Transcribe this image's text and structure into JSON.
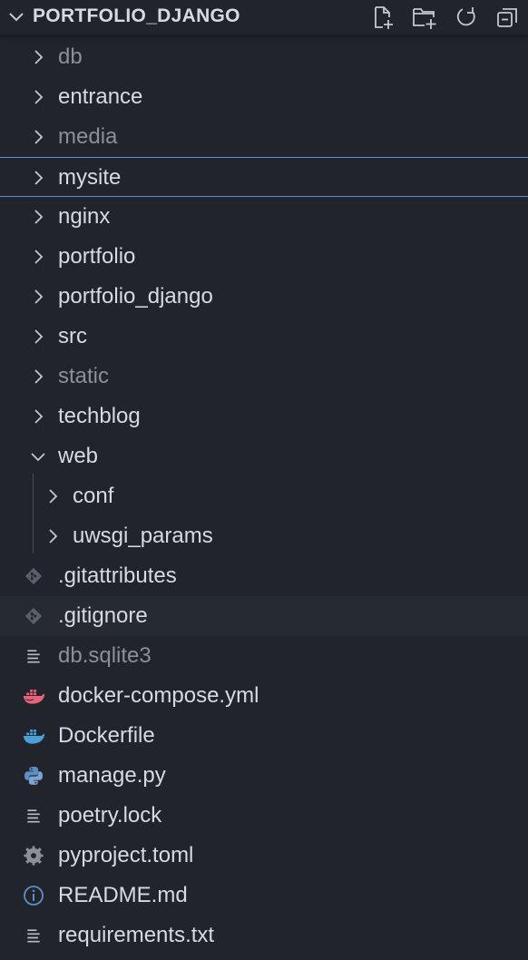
{
  "explorer": {
    "title": "PORTFOLIO_DJANGO",
    "actions": [
      {
        "icon": "new-file-icon"
      },
      {
        "icon": "new-folder-icon"
      },
      {
        "icon": "refresh-icon"
      },
      {
        "icon": "collapse-all-icon"
      }
    ],
    "items": [
      {
        "label": "db",
        "type": "folder",
        "dim": true
      },
      {
        "label": "entrance",
        "type": "folder"
      },
      {
        "label": "media",
        "type": "folder",
        "dim": true
      },
      {
        "label": "mysite",
        "type": "folder",
        "selected": true
      },
      {
        "label": "nginx",
        "type": "folder"
      },
      {
        "label": "portfolio",
        "type": "folder"
      },
      {
        "label": "portfolio_django",
        "type": "folder"
      },
      {
        "label": "src",
        "type": "folder"
      },
      {
        "label": "static",
        "type": "folder",
        "dim": true
      },
      {
        "label": "techblog",
        "type": "folder"
      },
      {
        "label": "web",
        "type": "folder",
        "expanded": true
      },
      {
        "label": "conf",
        "type": "folder",
        "depth": 1
      },
      {
        "label": "uwsgi_params",
        "type": "folder",
        "depth": 1
      },
      {
        "label": ".gitattributes",
        "type": "file",
        "icon": "git-icon"
      },
      {
        "label": ".gitignore",
        "type": "file",
        "icon": "git-icon",
        "hover": true
      },
      {
        "label": "db.sqlite3",
        "type": "file",
        "icon": "lines-icon",
        "dim": true
      },
      {
        "label": "docker-compose.yml",
        "type": "file",
        "icon": "docker-compose-icon"
      },
      {
        "label": "Dockerfile",
        "type": "file",
        "icon": "docker-icon"
      },
      {
        "label": "manage.py",
        "type": "file",
        "icon": "python-icon"
      },
      {
        "label": "poetry.lock",
        "type": "file",
        "icon": "lines-icon"
      },
      {
        "label": "pyproject.toml",
        "type": "file",
        "icon": "gear-icon"
      },
      {
        "label": "README.md",
        "type": "file",
        "icon": "info-icon"
      },
      {
        "label": "requirements.txt",
        "type": "file",
        "icon": "lines-icon"
      }
    ]
  },
  "colors": {
    "background": "#21252b",
    "text": "#d7dae0",
    "dim_text": "#8b9098",
    "selection_border": "#5a8ee6",
    "docker_compose": "#e8637a",
    "docker": "#4a9fd8",
    "python": "#5b8fc7"
  }
}
